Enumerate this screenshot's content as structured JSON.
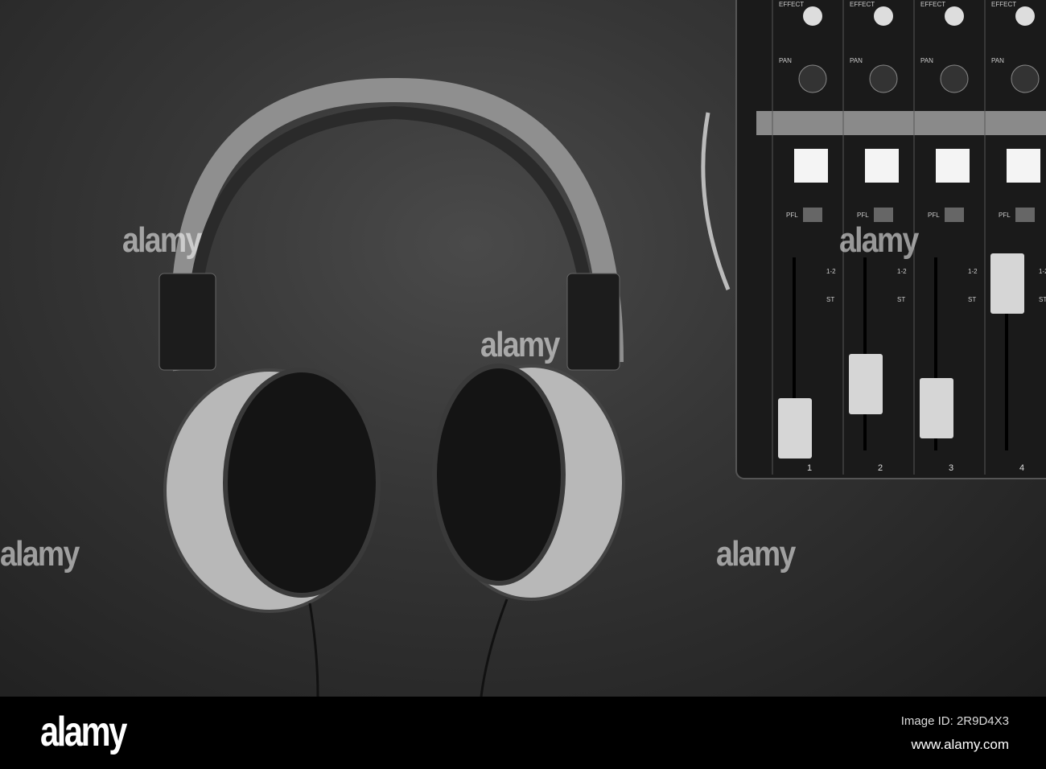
{
  "photo": {
    "subject": "headphones and audio mixer",
    "watermark": "alamy",
    "mixer": {
      "effect_label": "EFFECT",
      "pan_label": "PAN",
      "pfl_label": "PFL",
      "bus_label": "1-2",
      "stereo_label": "ST",
      "channels": [
        "1",
        "2",
        "3",
        "4"
      ]
    }
  },
  "footer": {
    "logo": "alamy",
    "image_id": "Image ID: 2R9D4X3",
    "website": "www.alamy.com"
  }
}
